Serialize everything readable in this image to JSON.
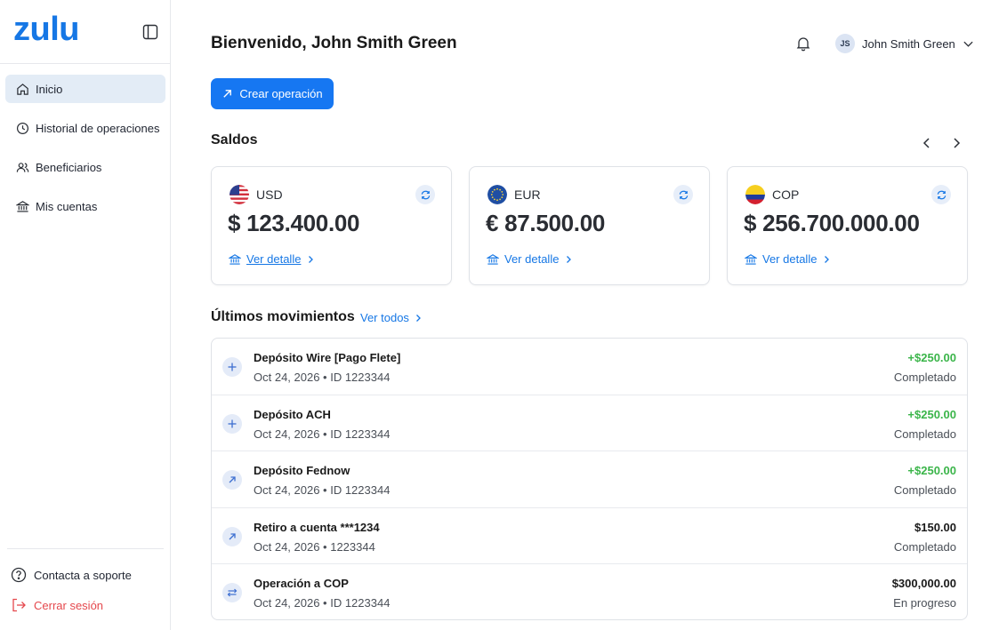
{
  "app": {
    "logo": "zulu"
  },
  "sidebar": {
    "items": [
      {
        "label": "Inicio",
        "icon": "home-icon",
        "active": true
      },
      {
        "label": "Historial de operaciones",
        "icon": "clock-icon"
      },
      {
        "label": "Beneficiarios",
        "icon": "users-icon"
      },
      {
        "label": "Mis cuentas",
        "icon": "bank-icon"
      }
    ],
    "support_label": "Contacta a soporte",
    "logout_label": "Cerrar sesión"
  },
  "header": {
    "title": "Bienvenido, John Smith Green",
    "user_initials": "JS",
    "user_name": "John Smith Green"
  },
  "create_button_label": "Crear operación",
  "balances": {
    "title": "Saldos",
    "cards": [
      {
        "currency": "USD",
        "amount": "$ 123.400.00",
        "detail_label": "Ver detalle"
      },
      {
        "currency": "EUR",
        "amount": "€ 87.500.00",
        "detail_label": "Ver detalle"
      },
      {
        "currency": "COP",
        "amount": "$ 256.700.000.00",
        "detail_label": "Ver detalle"
      }
    ]
  },
  "movements": {
    "title": "Últimos movimientos",
    "see_all_label": "Ver todos",
    "items": [
      {
        "icon": "plus-icon",
        "title": "Depósito Wire [Pago Flete]",
        "subtitle": "Oct 24, 2026 • ID 1223344",
        "amount": "+$250.00",
        "status": "Completado"
      },
      {
        "icon": "plus-icon",
        "title": "Depósito ACH",
        "subtitle": "Oct 24, 2026 • ID 1223344",
        "amount": "+$250.00",
        "status": "Completado"
      },
      {
        "icon": "arrow-up-right-icon",
        "title": "Depósito Fednow",
        "subtitle": "Oct 24, 2026 • ID 1223344",
        "amount": "+$250.00",
        "status": "Completado"
      },
      {
        "icon": "arrow-up-right-icon",
        "title": "Retiro a cuenta ***1234",
        "subtitle": "Oct 24, 2026 • 1223344",
        "amount": "$150.00",
        "status": "Completado"
      },
      {
        "icon": "swap-icon",
        "title": "Operación a COP",
        "subtitle": "Oct 24, 2026 • ID 1223344",
        "amount": "$300,000.00",
        "status": "En progreso"
      }
    ]
  },
  "colors": {
    "accent": "#1677f2",
    "positive": "#3bb54a",
    "danger": "#e5484d",
    "active_bg": "#e3ecf6"
  }
}
